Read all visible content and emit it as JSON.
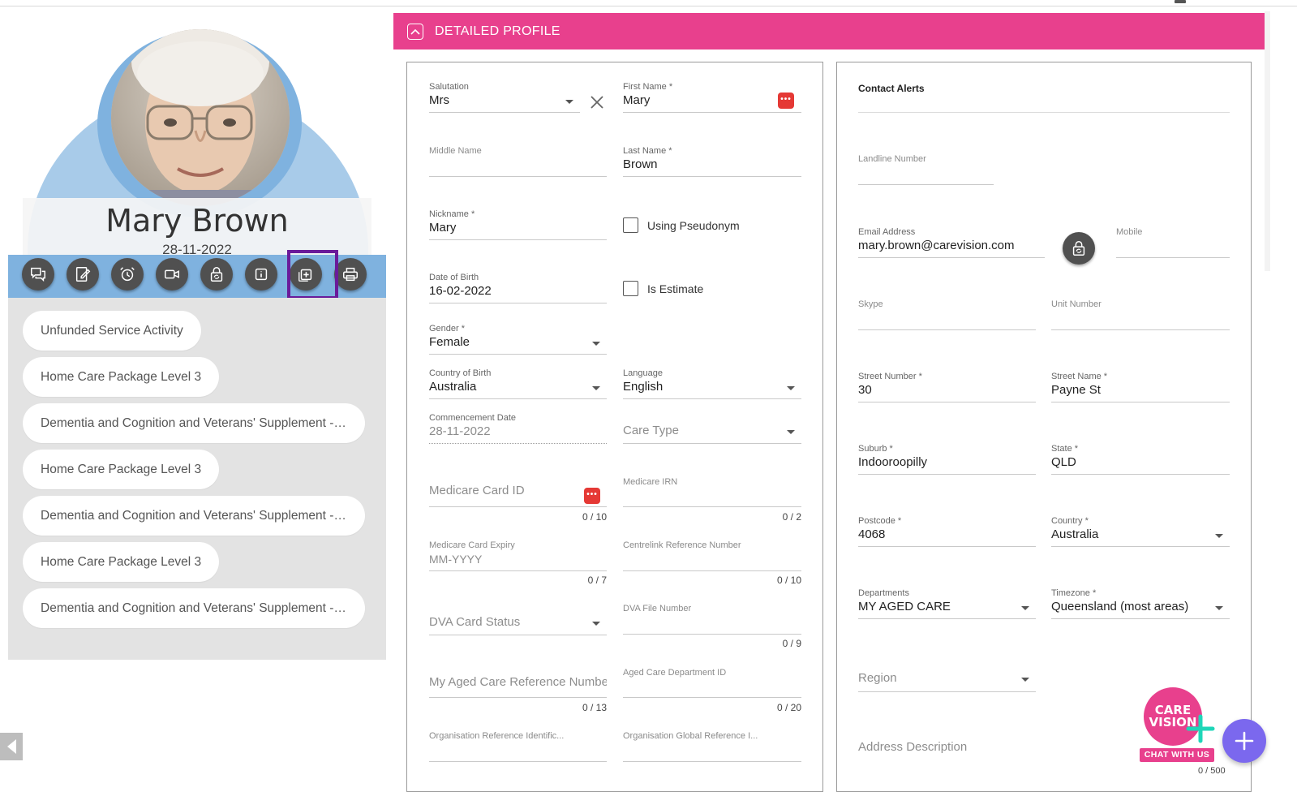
{
  "profile": {
    "name": "Mary Brown",
    "date": "28-11-2022",
    "actions": [
      {
        "name": "messages-icon"
      },
      {
        "name": "edit-note-icon"
      },
      {
        "name": "alarm-icon"
      },
      {
        "name": "video-call-icon"
      },
      {
        "name": "lock-reset-icon"
      },
      {
        "name": "info-icon"
      },
      {
        "name": "add-box-icon"
      },
      {
        "name": "print-icon"
      }
    ]
  },
  "services": [
    "Unfunded Service Activity",
    "Home Care Package Level 3",
    "Dementia and Cognition and Veterans' Supplement - ...",
    "Home Care Package Level 3",
    "Dementia and Cognition and Veterans' Supplement - ...",
    "Home Care Package Level 3",
    "Dementia and Cognition and Veterans' Supplement - ..."
  ],
  "header": {
    "title": "DETAILED PROFILE",
    "accent": "#e8408d"
  },
  "personal": {
    "salutation": {
      "label": "Salutation",
      "value": "Mrs"
    },
    "first_name": {
      "label": "First Name *",
      "value": "Mary"
    },
    "middle_name": {
      "label": "Middle Name",
      "value": ""
    },
    "last_name": {
      "label": "Last Name *",
      "value": "Brown"
    },
    "nickname": {
      "label": "Nickname *",
      "value": "Mary"
    },
    "using_pseudonym": {
      "label": "Using Pseudonym",
      "checked": false
    },
    "dob": {
      "label": "Date of Birth",
      "value": "16-02-2022"
    },
    "is_estimate": {
      "label": "Is Estimate",
      "checked": false
    },
    "gender": {
      "label": "Gender *",
      "value": "Female"
    },
    "country_of_birth": {
      "label": "Country of Birth",
      "value": "Australia"
    },
    "language": {
      "label": "Language",
      "value": "English"
    },
    "commencement_date": {
      "label": "Commencement Date",
      "value": "28-11-2022"
    },
    "care_type": {
      "placeholder": "Care Type"
    },
    "medicare_card_id": {
      "placeholder": "Medicare Card ID",
      "counter": "0 / 10"
    },
    "medicare_irn": {
      "label": "Medicare IRN",
      "counter": "0 / 2"
    },
    "medicare_card_expiry": {
      "label": "Medicare Card Expiry",
      "placeholder": "MM-YYYY",
      "counter": "0 / 7"
    },
    "centrelink_ref": {
      "label": "Centrelink Reference Number",
      "counter": "0 / 10"
    },
    "dva_card_status": {
      "placeholder": "DVA Card Status"
    },
    "dva_file_number": {
      "label": "DVA File Number",
      "counter": "0 / 9"
    },
    "my_aged_care_ref": {
      "placeholder": "My Aged Care Reference Number",
      "counter": "0 / 13"
    },
    "aged_care_dept_id": {
      "label": "Aged Care Department ID",
      "counter": "0 / 20"
    },
    "org_ref_id": {
      "label": "Organisation Reference Identific..."
    },
    "org_global_ref": {
      "label": "Organisation Global Reference I..."
    }
  },
  "contact": {
    "alerts_title": "Contact Alerts",
    "landline": {
      "label": "Landline Number",
      "value": ""
    },
    "email": {
      "label": "Email Address",
      "value": "mary.brown@carevision.com"
    },
    "mobile": {
      "label": "Mobile",
      "value": ""
    },
    "skype": {
      "label": "Skype",
      "value": ""
    },
    "unit_number": {
      "label": "Unit Number",
      "value": ""
    },
    "street_number": {
      "label": "Street Number *",
      "value": "30"
    },
    "street_name": {
      "label": "Street Name *",
      "value": "Payne St"
    },
    "suburb": {
      "label": "Suburb *",
      "value": "Indooroopilly"
    },
    "state": {
      "label": "State *",
      "value": "QLD"
    },
    "postcode": {
      "label": "Postcode *",
      "value": "4068"
    },
    "country": {
      "label": "Country *",
      "value": "Australia"
    },
    "departments": {
      "label": "Departments",
      "value": "MY AGED CARE"
    },
    "timezone": {
      "label": "Timezone *",
      "value": "Queensland (most areas)"
    },
    "region": {
      "placeholder": "Region"
    },
    "address_description": {
      "placeholder": "Address Description",
      "counter": "0 / 500"
    }
  },
  "chat": {
    "logo_line1": "CARE",
    "logo_line2": "VISION",
    "label": "CHAT WITH US"
  }
}
